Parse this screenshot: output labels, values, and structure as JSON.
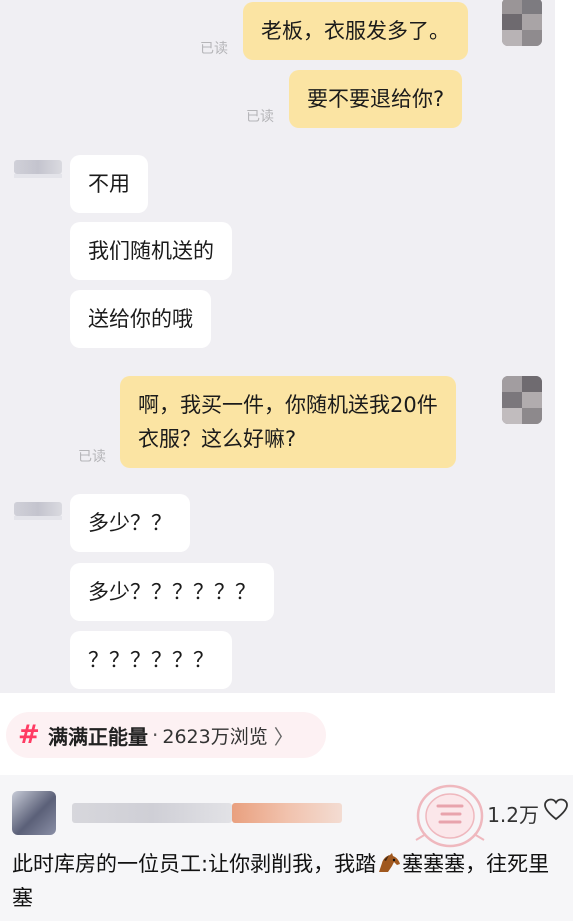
{
  "messages": [
    {
      "side": "right",
      "text": "老板，衣服发多了。",
      "read": "已读"
    },
    {
      "side": "right",
      "text": "要不要退给你?",
      "read": "已读"
    },
    {
      "side": "left",
      "text": "不用"
    },
    {
      "side": "left",
      "text": "我们随机送的"
    },
    {
      "side": "left",
      "text": "送给你的哦"
    },
    {
      "side": "right",
      "text_line1": "啊，我买一件，你随机送我20件",
      "text_line2": "衣服？这么好嘛?",
      "read": "已读"
    },
    {
      "side": "left",
      "text": "多少？？"
    },
    {
      "side": "left",
      "text": "多少？？？？？？"
    },
    {
      "side": "left",
      "text": "？？？？？？"
    }
  ],
  "topic": {
    "icon": "#",
    "name": "满满正能量",
    "separator": "·",
    "views": "2623万浏览",
    "chevron": "〉"
  },
  "comment": {
    "likes": "1.2万",
    "text_before": "此时库房的一位员工:让你剥削我，我踏",
    "text_after": "塞塞塞，往死里塞"
  },
  "colors": {
    "chat_bg": "#f0eff3",
    "my_bubble": "#fbe4a3",
    "their_bubble": "#ffffff",
    "topic_accent": "#ff3b63",
    "watermark": "#e8a3ac"
  }
}
